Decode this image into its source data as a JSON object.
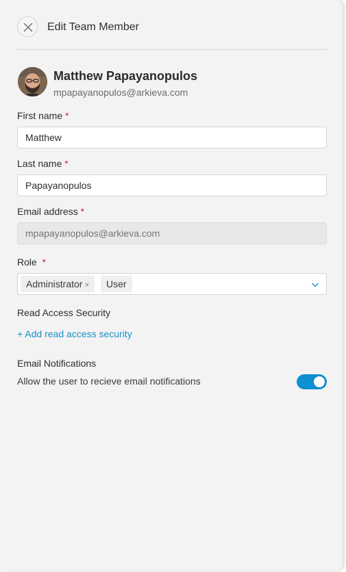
{
  "header": {
    "title": "Edit Team Member",
    "close_icon": "close-icon"
  },
  "profile": {
    "name": "Matthew Papayanopulos",
    "email": "mpapayanopulos@arkieva.com"
  },
  "form": {
    "first_name": {
      "label": "First name",
      "required_mark": "*",
      "value": "Matthew"
    },
    "last_name": {
      "label": "Last name",
      "required_mark": "*",
      "value": "Papayanopulos"
    },
    "email": {
      "label": "Email address",
      "required_mark": "*",
      "placeholder": "mpapayanopulos@arkieva.com"
    },
    "role": {
      "label": "Role",
      "required_mark": "*",
      "tags": [
        {
          "label": "Administrator",
          "remove_icon": "×"
        },
        {
          "label": "User"
        }
      ],
      "chevron_icon": "chevron-down-icon"
    }
  },
  "read_access": {
    "title": "Read Access Security",
    "add_link": "+ Add read access security"
  },
  "notifications": {
    "title": "Email Notifications",
    "description": "Allow the user to recieve email notifications",
    "enabled": true
  },
  "colors": {
    "accent": "#0e8fd1",
    "link": "#1a8fc7",
    "required": "#d8262f",
    "panel_bg": "#f3f3f3"
  }
}
